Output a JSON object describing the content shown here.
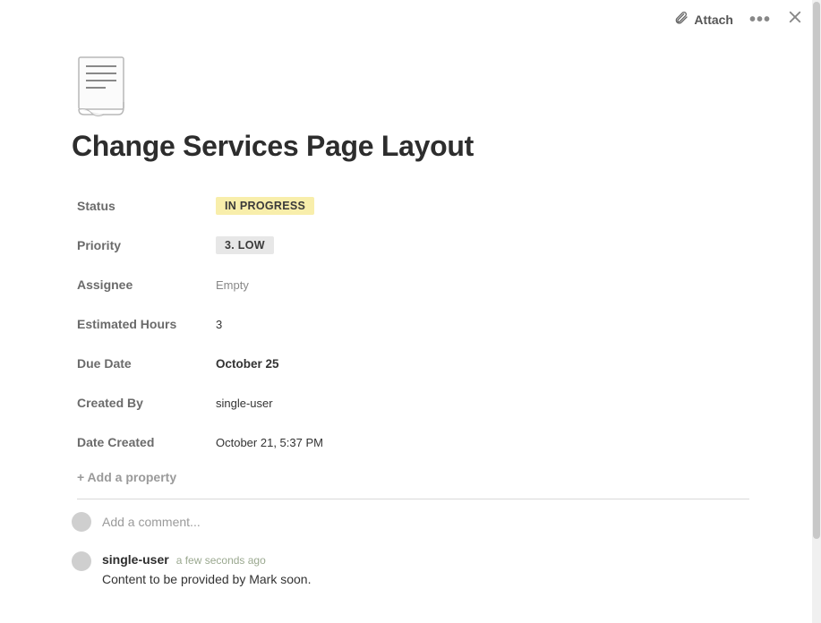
{
  "header": {
    "attach_label": "Attach"
  },
  "page": {
    "title": "Change Services Page Layout"
  },
  "properties": {
    "status": {
      "label": "Status",
      "value": "IN PROGRESS"
    },
    "priority": {
      "label": "Priority",
      "value": "3. LOW"
    },
    "assignee": {
      "label": "Assignee",
      "value": "Empty"
    },
    "estimated_hours": {
      "label": "Estimated Hours",
      "value": "3"
    },
    "due_date": {
      "label": "Due Date",
      "value": "October 25"
    },
    "created_by": {
      "label": "Created By",
      "value": "single-user"
    },
    "date_created": {
      "label": "Date Created",
      "value": "October 21, 5:37 PM"
    },
    "add_label": "+ Add a property"
  },
  "comments": {
    "placeholder": "Add a comment...",
    "items": [
      {
        "author": "single-user",
        "time": "a few seconds ago",
        "text": "Content to be provided by Mark soon."
      }
    ]
  }
}
